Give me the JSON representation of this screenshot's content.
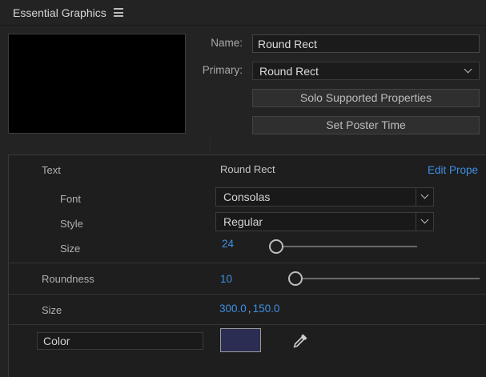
{
  "panel": {
    "title": "Essential Graphics",
    "menu_icon": "hamburger-menu-icon"
  },
  "clip": {
    "name_label": "Name:",
    "name_value": "Round Rect",
    "primary_label": "Primary:",
    "primary_value": "Round Rect",
    "solo_button": "Solo Supported Properties",
    "poster_button": "Set Poster Time"
  },
  "properties": {
    "text": {
      "label": "Text",
      "value": "Round Rect",
      "edit_link": "Edit Prope",
      "font_label": "Font",
      "font_value": "Consolas",
      "style_label": "Style",
      "style_value": "Regular",
      "size_label": "Size",
      "size_value": "24"
    },
    "roundness": {
      "label": "Roundness",
      "value": "10"
    },
    "size": {
      "label": "Size",
      "value_w": "300.0",
      "separator": ",",
      "value_h": "150.0"
    },
    "color": {
      "label": "Color",
      "swatch": "#2b2d52",
      "eyedropper_icon": "eyedropper-icon"
    }
  },
  "colors": {
    "accent": "#3e8fe6",
    "panel_bg": "#232323",
    "props_bg": "#1e1e1e"
  }
}
